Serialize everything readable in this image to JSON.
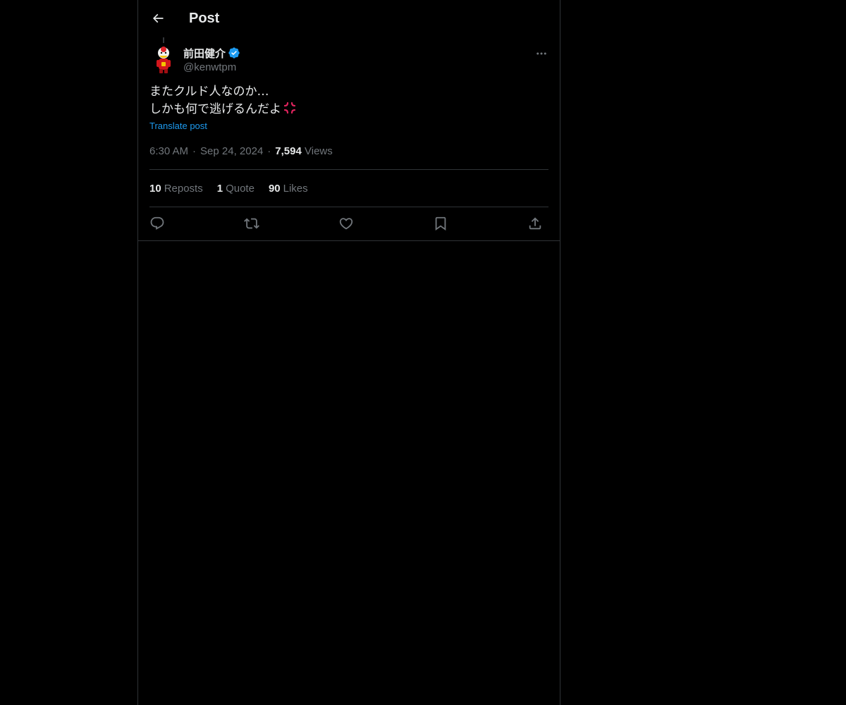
{
  "header": {
    "title": "Post",
    "back_icon": "arrow-left-icon"
  },
  "author": {
    "name": "前田健介",
    "handle": "@kenwtpm",
    "verified": true,
    "verified_color": "#1d9bf0"
  },
  "post": {
    "lines": [
      "またクルド人なのか…",
      "しかも何で逃げるんだよ"
    ],
    "emoji": "anger-symbol-icon",
    "translate_label": "Translate post",
    "time": "6:30 AM",
    "date": "Sep 24, 2024",
    "views_count": "7,594",
    "views_label": "Views"
  },
  "stats": {
    "reposts_count": "10",
    "reposts_label": "Reposts",
    "quotes_count": "1",
    "quotes_label": "Quote",
    "likes_count": "90",
    "likes_label": "Likes"
  },
  "actions": [
    "reply-icon",
    "repost-icon",
    "like-icon",
    "bookmark-icon",
    "share-icon"
  ],
  "colors": {
    "background": "#000000",
    "text": "#e7e9ea",
    "secondary": "#71767b",
    "accent": "#1d9bf0",
    "border": "#2f3336"
  }
}
